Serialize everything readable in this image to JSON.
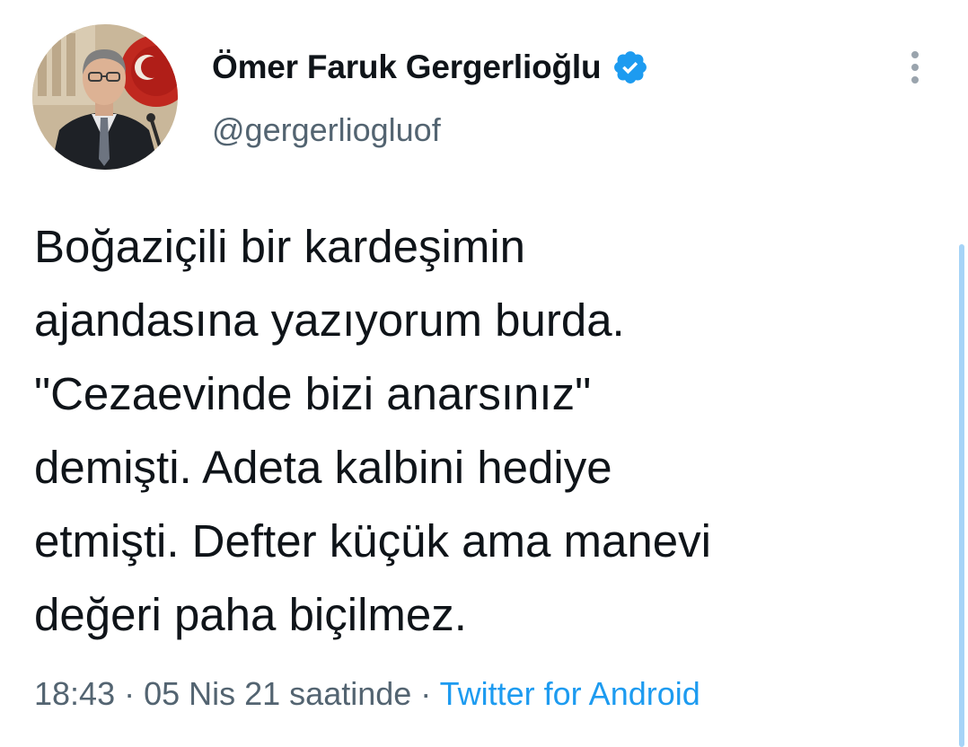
{
  "author": {
    "display_name": "Ömer Faruk Gergerlioğlu",
    "handle": "@gergerliogluof",
    "verified": true,
    "avatar_icon": "user-avatar-photo"
  },
  "tweet": {
    "text": "Boğaziçili bir kardeşimin\najandasına yazıyorum burda.\n\"Cezaevinde bizi anarsınız\"\ndemişti. Adeta kalbini hediye\netmişti. Defter küçük ama manevi\ndeğeri paha biçilmez."
  },
  "meta": {
    "time": "18:43",
    "separator_1": " · ",
    "date": "05 Nis 21 saatinde",
    "separator_2": " · ",
    "source": "Twitter for Android"
  },
  "icons": {
    "verified": "verified-badge-icon",
    "more": "more-vertical-icon"
  },
  "colors": {
    "accent": "#1d9bf0",
    "text_primary": "#0f1419",
    "text_secondary": "#536471",
    "scroll_indicator": "#a6d4f7"
  }
}
